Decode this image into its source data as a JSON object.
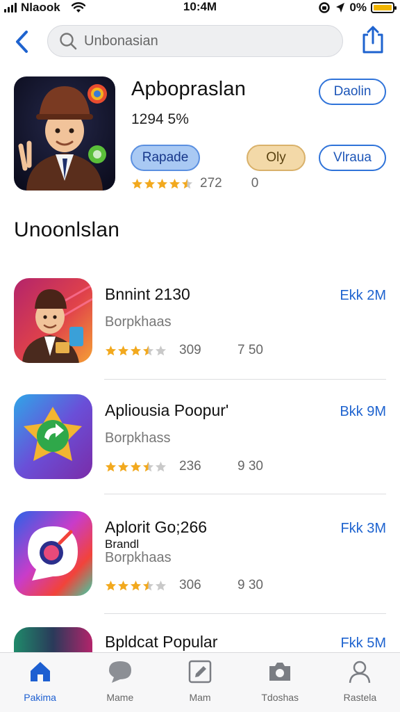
{
  "status_bar": {
    "carrier": "Nlaook",
    "time": "10:4M",
    "battery_text": "0%"
  },
  "search": {
    "query": "Unbonasian"
  },
  "hero": {
    "title": "Apbopraslan",
    "subtitle": "1294 5%",
    "buttons": {
      "top_right": "Daolin",
      "primary": "Rapade",
      "secondary": "Oly",
      "outline": "Vlraua"
    },
    "rating_stars": 4.5,
    "rating_count": "272",
    "rating_extra": "0"
  },
  "section_title": "Unoonlslan",
  "apps": [
    {
      "title": "Bnnint 2130",
      "subtitle": "Borpkhaas",
      "size": "Ekk 2M",
      "rating_stars": 3.5,
      "rating_count": "309",
      "rating_extra": "7 50",
      "icon": "character-icon"
    },
    {
      "title": "Apliousia Poopur'",
      "subtitle": "Borpkhass",
      "size": "Bkk 9M",
      "rating_stars": 3.5,
      "rating_count": "236",
      "rating_extra": "9 30",
      "icon": "star-arrow-icon"
    },
    {
      "title": "Aplorit Go;266",
      "note": "Brandl",
      "subtitle": "Borpkhaas",
      "size": "Fkk 3M",
      "rating_stars": 3.5,
      "rating_count": "306",
      "rating_extra": "9 30",
      "icon": "chat-bubble-icon"
    },
    {
      "title": "Bpldcat Popular",
      "size": "Fkk 5M",
      "icon": "gradient-icon"
    }
  ],
  "tabs": [
    {
      "label": "Pakima",
      "icon": "home-icon",
      "active": true
    },
    {
      "label": "Mame",
      "icon": "chat-icon",
      "active": false
    },
    {
      "label": "Mam",
      "icon": "edit-icon",
      "active": false
    },
    {
      "label": "Tdoshas",
      "icon": "camera-icon",
      "active": false
    },
    {
      "label": "Rastela",
      "icon": "profile-icon",
      "active": false
    }
  ],
  "colors": {
    "accent": "#1e63cf",
    "star": "#f2a91e",
    "star_empty": "#c9c9c9"
  }
}
